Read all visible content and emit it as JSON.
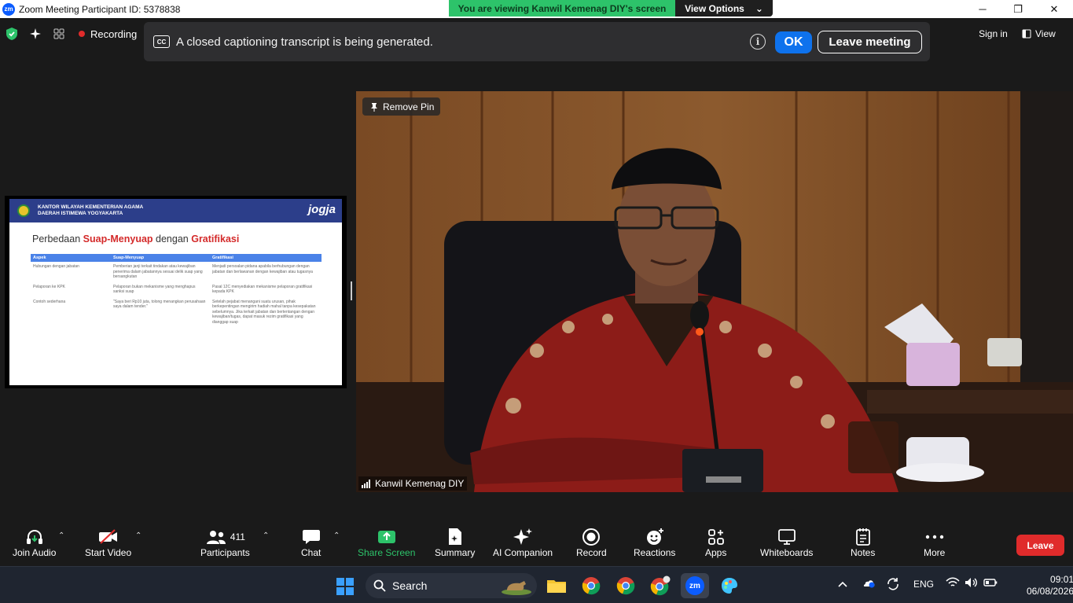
{
  "window": {
    "title": "Zoom Meeting Participant ID: 5378838",
    "logo_text": "zm",
    "controls": {
      "minimize": "─",
      "restore": "❐",
      "close": "✕"
    }
  },
  "share_banner": {
    "text": "You are viewing Kanwil Kemenag DIY's screen",
    "view_options_label": "View Options",
    "view_options_chevron": "⌄",
    "color": "#2dc36a"
  },
  "meeting_bar": {
    "recording_label": "Recording",
    "sign_in_label": "Sign in",
    "view_label": "View"
  },
  "caption_notice": {
    "cc_icon_text": "CC",
    "text": "A closed captioning transcript is being generated.",
    "info_icon_text": "i",
    "ok_label": "OK",
    "leave_meeting_label": "Leave meeting"
  },
  "shared_slide": {
    "org_line1": "KANTOR WILAYAH KEMENTERIAN AGAMA",
    "org_line2": "DAERAH ISTIMEWA YOGYAKARTA",
    "brand": "jogja",
    "title_prefix": "Perbedaan ",
    "title_term1": "Suap-Menyuap",
    "title_mid": " dengan ",
    "title_term2": "Gratifikasi",
    "columns": [
      "Aspek",
      "Suap-Menyuap",
      "Gratifikasi"
    ],
    "rows": [
      [
        "Hubungan dengan jabatan",
        "Pemberian janji terkait tindakan atau kewajiban penerima dalam jabatannya sesuai delik suap yang bersangkutan",
        "Menjadi persoalan pidana apabila berhubungan dengan jabatan dan berlawanan dengan kewajiban atau tugasnya"
      ],
      [
        "Pelaporan ke KPK",
        "Pelaporan bukan mekanisme yang menghapus sanksi suap",
        "Pasal 12C menyediakan mekanisme pelaporan gratifikasi kepada KPK"
      ],
      [
        "Contoh sederhana",
        "\"Saya beri Rp10 juta, tolong menangkan perusahaan saya dalam tender.\"",
        "Setelah pejabat menangani suatu urusan, pihak berkepentingan mengirim hadiah mahal tanpa kesepakatan sebelumnya. Jika terkait jabatan dan bertentangan dengan kewajiban/tugas, dapat masuk rezim gratifikasi yang dianggap suap"
      ]
    ]
  },
  "video": {
    "remove_pin_label": "Remove Pin",
    "participant_name": "Kanwil Kemenag DIY"
  },
  "toolbar": {
    "join_audio": "Join Audio",
    "start_video": "Start Video",
    "participants": "Participants",
    "participants_count": "411",
    "chat": "Chat",
    "share_screen": "Share Screen",
    "summary": "Summary",
    "ai_companion": "AI Companion",
    "record": "Record",
    "reactions": "Reactions",
    "apps": "Apps",
    "whiteboards": "Whiteboards",
    "notes": "Notes",
    "more": "More",
    "leave": "Leave",
    "caret": "⌃"
  },
  "taskbar": {
    "search_label": "Search",
    "language": "ENG",
    "time": "09:01",
    "date": "06/08/2026"
  }
}
